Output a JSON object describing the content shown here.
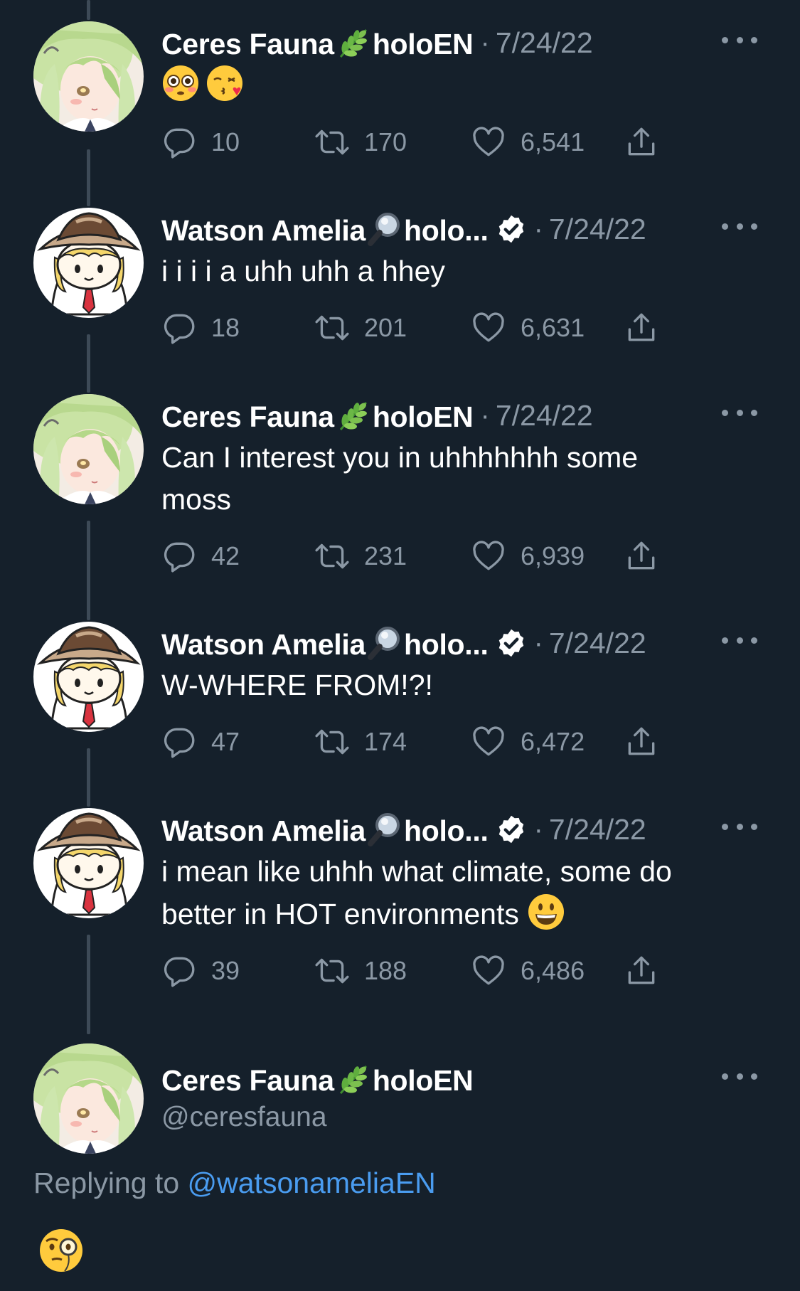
{
  "tweets": [
    {
      "author": "fauna",
      "name_before": "Ceres Fauna",
      "name_emoji": "herb-icon",
      "name_after": "holoEN",
      "verified": false,
      "separator": "·",
      "date": "7/24/22",
      "text": "",
      "emojis": [
        "flushed-face-emoji",
        "face-blowing-kiss-emoji"
      ],
      "replies": "10",
      "retweets": "170",
      "likes": "6,541"
    },
    {
      "author": "amelia",
      "name_before": "Watson Amelia",
      "name_emoji": "magnifying-glass-icon",
      "name_after": "holo...",
      "verified": true,
      "separator": "·",
      "date": "7/24/22",
      "text": "i i i i a uhh uhh a hhey",
      "replies": "18",
      "retweets": "201",
      "likes": "6,631"
    },
    {
      "author": "fauna",
      "name_before": "Ceres Fauna",
      "name_emoji": "herb-icon",
      "name_after": "holoEN",
      "verified": false,
      "separator": "·",
      "date": "7/24/22",
      "text_line1": "Can I interest you in uhhhhhhh some",
      "text_line2": "moss",
      "replies": "42",
      "retweets": "231",
      "likes": "6,939"
    },
    {
      "author": "amelia",
      "name_before": "Watson Amelia",
      "name_emoji": "magnifying-glass-icon",
      "name_after": "holo...",
      "verified": true,
      "separator": "·",
      "date": "7/24/22",
      "text": "W-WHERE FROM!?!",
      "replies": "47",
      "retweets": "174",
      "likes": "6,472"
    },
    {
      "author": "amelia",
      "name_before": "Watson Amelia",
      "name_emoji": "magnifying-glass-icon",
      "name_after": "holo...",
      "verified": true,
      "separator": "·",
      "date": "7/24/22",
      "text_line1": "i mean like uhhh what climate, some do",
      "text_line2": "better in HOT environments",
      "trailing_emoji": "grinning-face-emoji",
      "replies": "39",
      "retweets": "188",
      "likes": "6,486"
    }
  ],
  "focused": {
    "name_before": "Ceres Fauna",
    "name_emoji": "herb-icon",
    "name_after": "holoEN",
    "handle": "@ceresfauna",
    "replying_prefix": "Replying to ",
    "replying_mention": "@watsonameliaEN",
    "body_emoji": "face-with-monocle-emoji"
  },
  "colors": {
    "background": "#15202b",
    "secondary_text": "#8b98a5",
    "link": "#4a9cf0",
    "thread_line": "#3d4a57"
  }
}
